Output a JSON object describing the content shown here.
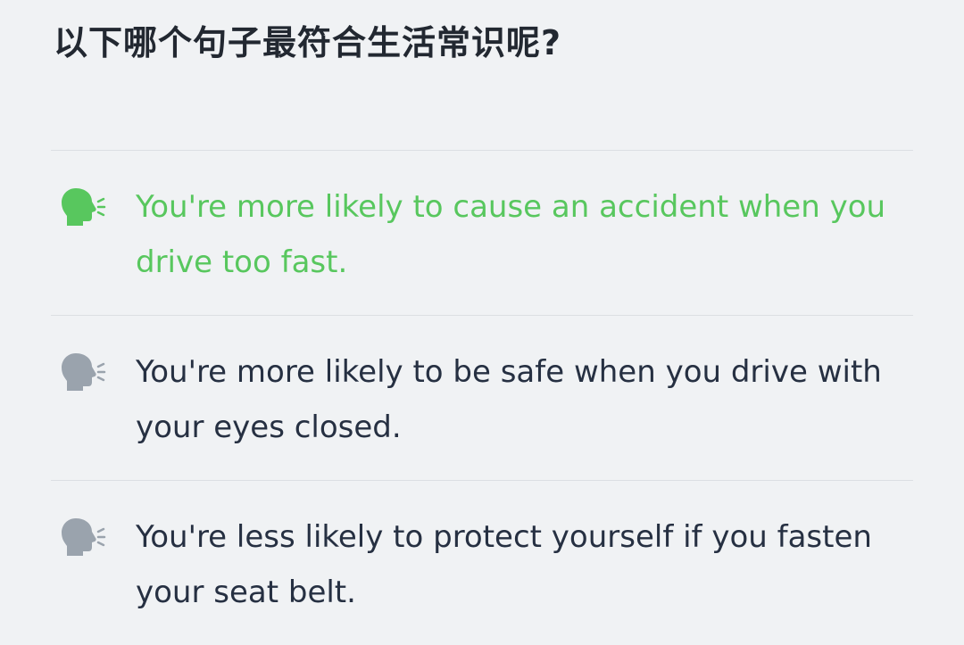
{
  "question": "以下哪个句子最符合生活常识呢?",
  "options": [
    {
      "text": "You're more likely to cause an accident when you drive too fast.",
      "icon": "speaking-head-icon",
      "selected": true
    },
    {
      "text": "You're more likely to be safe when you drive with your eyes closed.",
      "icon": "speaking-head-icon",
      "selected": false
    },
    {
      "text": "You're less likely to protect yourself if you fasten your seat belt.",
      "icon": "speaking-head-icon",
      "selected": false
    }
  ],
  "colors": {
    "background": "#f0f2f4",
    "selected": "#58c75e",
    "text": "#263042",
    "icon_inactive": "#9aa3ad",
    "divider": "#dcdfe3"
  }
}
